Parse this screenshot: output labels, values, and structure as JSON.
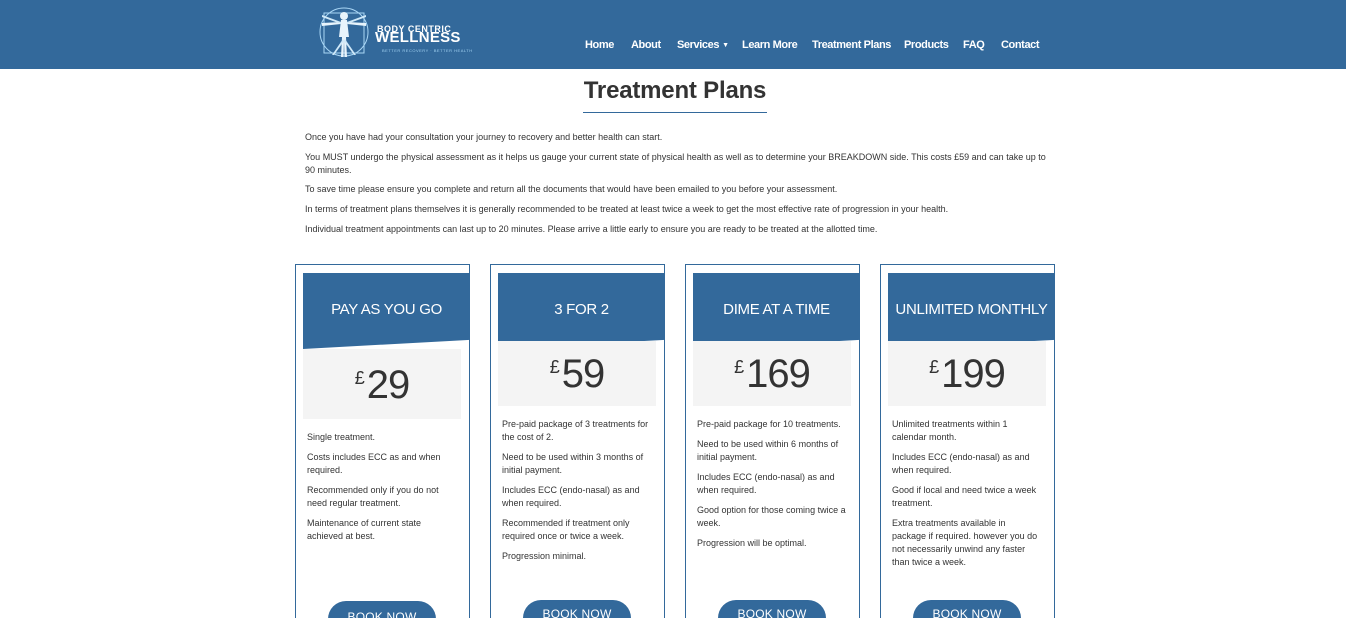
{
  "brand": {
    "name_top": "BODY CENTRIC",
    "name_main": "WELLNESS",
    "tagline": "BETTER RECOVERY · BETTER HEALTH",
    "logo_icon": "vitruvian-man-icon"
  },
  "nav": {
    "items": [
      "Home",
      "About",
      "Services",
      "Learn More",
      "Treatment Plans",
      "Products",
      "FAQ",
      "Contact"
    ]
  },
  "page": {
    "title": "Treatment Plans",
    "intro": [
      "Once you have had your consultation your journey to recovery and better health can start.",
      "You MUST undergo the physical assessment as it helps us gauge your current state of physical health as well as to determine your BREAKDOWN side. This costs £59 and can take up to 90 minutes.",
      "To save time please ensure you complete and return all the documents that would have been emailed to you before your assessment.",
      "In terms of treatment plans themselves it is generally recommended to be treated at least twice a week to get the most effective rate of progression in your health.",
      "Individual treatment appointments can last up to 20 minutes. Please arrive a little early to ensure you are ready to be treated at the allotted time."
    ]
  },
  "plans": [
    {
      "name": "PAY AS YOU GO",
      "currency": "£",
      "price": "29",
      "features": [
        "Single treatment.",
        "Costs includes ECC as and when required.",
        "Recommended only if you do not need regular treatment.",
        "Maintenance of current state achieved at best."
      ],
      "button": "BOOK NOW"
    },
    {
      "name": "3 FOR 2",
      "currency": "£",
      "price": "59",
      "features": [
        "Pre-paid package of 3 treatments for the cost of 2.",
        "Need to be used within 3 months of initial payment.",
        "Includes ECC (endo-nasal) as and when required.",
        "Recommended if treatment only required once or twice a week.",
        "Progression minimal."
      ],
      "button": "BOOK NOW"
    },
    {
      "name": "DIME AT A TIME",
      "currency": "£",
      "price": "169",
      "features": [
        "Pre-paid package for 10 treatments.",
        "Need to be used within 6 months of initial payment.",
        "Includes ECC (endo-nasal) as and when required.",
        "Good option for those coming twice a week.",
        "Progression will be optimal."
      ],
      "button": "BOOK NOW"
    },
    {
      "name": "UNLIMITED MONTHLY",
      "currency": "£",
      "price": "199",
      "features": [
        "Unlimited treatments within 1 calendar month.",
        "Includes ECC (endo-nasal) as and when required.",
        "Good if local and need twice a week treatment.",
        "Extra treatments available in package if required. however you do not necessarily unwind any faster than twice a week."
      ],
      "button": "BOOK NOW"
    }
  ],
  "colors": {
    "brand_blue": "#33699b",
    "price_bg": "#f4f4f4",
    "text": "#333333"
  }
}
